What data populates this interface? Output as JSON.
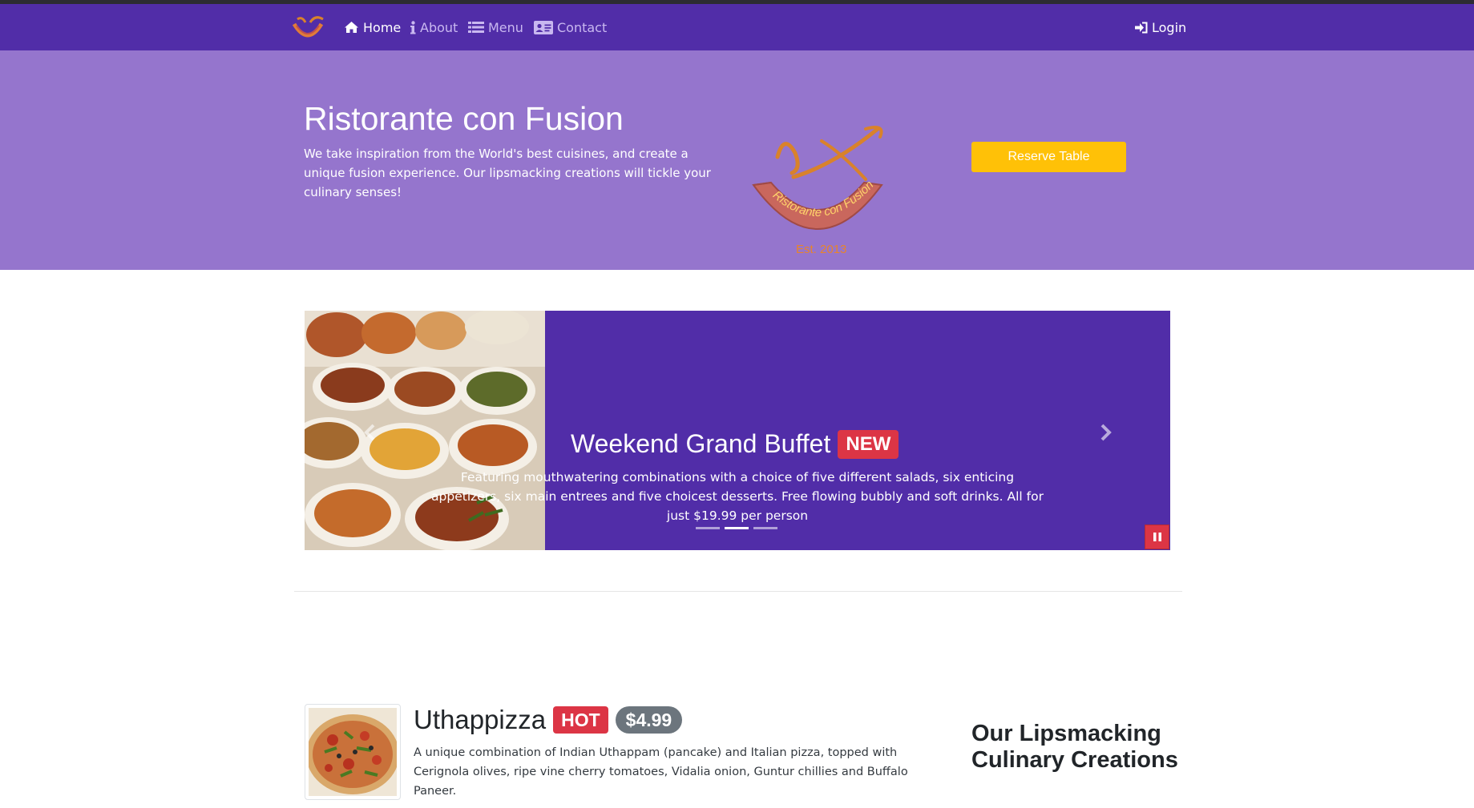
{
  "navbar": {
    "brand_icon": "restaurant-logo",
    "items": [
      {
        "label": "Home",
        "icon": "home-icon",
        "active": true
      },
      {
        "label": "About",
        "icon": "info-icon",
        "active": false
      },
      {
        "label": "Menu",
        "icon": "list-icon",
        "active": false
      },
      {
        "label": "Contact",
        "icon": "address-card-icon",
        "active": false
      }
    ],
    "login": {
      "label": "Login",
      "icon": "sign-in-icon"
    }
  },
  "jumbotron": {
    "title": "Ristorante con Fusion",
    "text": "We take inspiration from the World's best cuisines, and create a unique fusion experience. Our lipsmacking creations will tickle your culinary senses!",
    "logo_text": "Ristorante con Fusion",
    "logo_est": "Est. 2013",
    "reserve_label": "Reserve Table"
  },
  "carousel": {
    "title": "Weekend Grand Buffet",
    "badge": "NEW",
    "text": "Featuring mouthwatering combinations with a choice of five different salads, six enticing appetizers, six main entrees and five choicest desserts. Free flowing bubbly and soft drinks. All for just $19.99 per person",
    "active_indicator": 2,
    "indicator_count": 3
  },
  "dish": {
    "name": "Uthappizza",
    "badge": "HOT",
    "price": "$4.99",
    "description": "A unique combination of Indian Uthappam (pancake) and Italian pizza, topped with Cerignola olives, ripe vine cherry tomatoes, Vidalia onion, Guntur chillies and Buffalo Paneer."
  },
  "side": {
    "heading": "Our Lipsmacking Culinary Creations"
  },
  "colors": {
    "primary": "#512da8",
    "light_primary": "#9575cd",
    "warning": "#ffc107",
    "danger": "#dc3545",
    "secondary": "#6c757d"
  }
}
